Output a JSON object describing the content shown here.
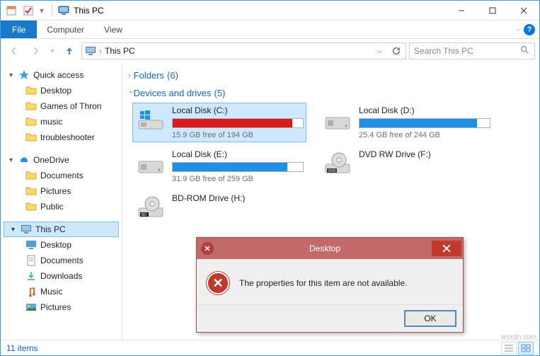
{
  "window": {
    "title": "This PC",
    "minimize_tip": "Minimize",
    "maximize_tip": "Maximize",
    "close_tip": "Close"
  },
  "ribbon": {
    "file": "File",
    "tabs": [
      "Computer",
      "View"
    ],
    "expand_tip": "v",
    "help_tip": "?"
  },
  "nav": {
    "back": "Back",
    "forward": "Forward",
    "up": "Up",
    "address": "This PC",
    "refresh": "Refresh",
    "search_placeholder": "Search This PC"
  },
  "sidebar": {
    "quick_access": "Quick access",
    "quick_items": [
      "Desktop",
      "Games of Thron",
      "music",
      "troubleshooter"
    ],
    "onedrive": "OneDrive",
    "onedrive_items": [
      "Documents",
      "Pictures",
      "Public"
    ],
    "this_pc": "This PC",
    "this_pc_items": [
      "Desktop",
      "Documents",
      "Downloads",
      "Music",
      "Pictures"
    ]
  },
  "groups": {
    "folders": {
      "title": "Folders",
      "count": "(6)"
    },
    "devices": {
      "title": "Devices and drives",
      "count": "(5)"
    }
  },
  "drives": [
    {
      "name": "Local Disk (C:)",
      "free": "15.9 GB free of 194 GB",
      "fill_pct": 92,
      "color": "red",
      "icon": "win",
      "selected": true
    },
    {
      "name": "Local Disk (D:)",
      "free": "25.4 GB free of 244 GB",
      "fill_pct": 90,
      "color": "blue",
      "icon": "hdd",
      "selected": false
    },
    {
      "name": "Local Disk (E:)",
      "free": "31.9 GB free of 259 GB",
      "fill_pct": 88,
      "color": "blue",
      "icon": "hdd",
      "selected": false
    },
    {
      "name": "DVD RW Drive (F:)",
      "free": "",
      "fill_pct": 0,
      "color": "",
      "icon": "dvd",
      "selected": false
    },
    {
      "name": "BD-ROM Drive (H:)",
      "free": "",
      "fill_pct": 0,
      "color": "",
      "icon": "bd",
      "selected": false
    }
  ],
  "status": {
    "items": "11 items"
  },
  "dialog": {
    "title": "Desktop",
    "message": "The properties for this item are not available.",
    "ok": "OK"
  },
  "watermark": "wsxdn.com"
}
